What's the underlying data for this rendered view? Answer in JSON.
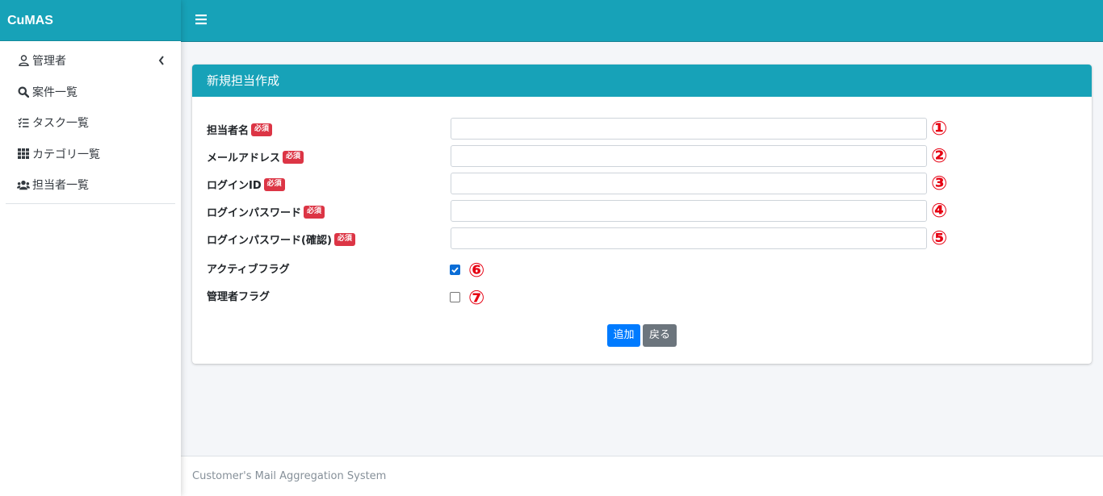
{
  "app": {
    "brand": "CuMAS"
  },
  "sidebar": {
    "items": [
      {
        "label": "管理者",
        "icon": "user-icon",
        "has_chevron": true
      },
      {
        "label": "案件一覧",
        "icon": "search-icon"
      },
      {
        "label": "タスク一覧",
        "icon": "tasks-icon"
      },
      {
        "label": "カテゴリ一覧",
        "icon": "grid-icon"
      },
      {
        "label": "担当者一覧",
        "icon": "users-icon"
      }
    ]
  },
  "topbar": {
    "menu_icon": "hamburger-icon"
  },
  "card": {
    "title": "新規担当作成"
  },
  "form": {
    "required_badge": "必須",
    "fields": [
      {
        "label": "担当者名",
        "required": true,
        "value": "",
        "marker": "①"
      },
      {
        "label": "メールアドレス",
        "required": true,
        "value": "",
        "marker": "②"
      },
      {
        "label": "ログインID",
        "required": true,
        "value": "",
        "marker": "③"
      },
      {
        "label": "ログインパスワード",
        "required": true,
        "value": "",
        "marker": "④"
      },
      {
        "label": "ログインパスワード(確認)",
        "required": true,
        "value": "",
        "marker": "⑤"
      }
    ],
    "checkboxes": [
      {
        "label": "アクティブフラグ",
        "checked": true,
        "marker": "⑥"
      },
      {
        "label": "管理者フラグ",
        "checked": false,
        "marker": "⑦"
      }
    ],
    "buttons": {
      "add": "追加",
      "back": "戻る"
    }
  },
  "footer": {
    "text": "Customer's Mail Aggregation System"
  },
  "colors": {
    "accent": "#17a2b8",
    "primary": "#007bff",
    "secondary": "#6c757d",
    "danger": "#dc3545",
    "marker": "#e60012"
  }
}
